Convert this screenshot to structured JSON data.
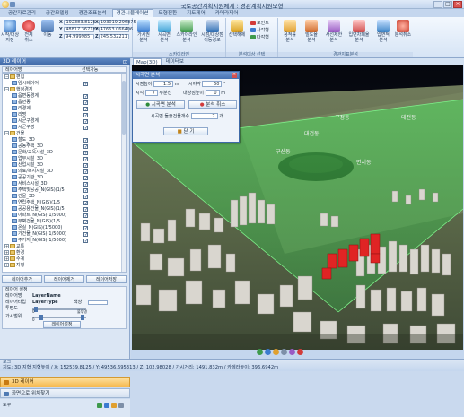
{
  "window": {
    "title": "국토공간계획지원체계 : 경관계획지원모형",
    "min": "–",
    "max": "□",
    "close": "×"
  },
  "tabs": [
    "공간자료관리",
    "공간모델링",
    "경관조표분석",
    "경관시뮬레이션",
    "모형전환",
    "지도제어",
    "카메라제어"
  ],
  "active_tab": 4,
  "ribbon": {
    "home_buttons": [
      {
        "label": "시작/대상\n지정",
        "icon": "globe-icon",
        "color": "#3b7bd0"
      },
      {
        "label": "전체\n취소",
        "icon": "cancel-icon",
        "color": "#d23b3b"
      },
      {
        "label": "이동",
        "icon": "move-icon",
        "color": "#5a86c6"
      }
    ],
    "coords": {
      "x_label": "X",
      "x": "192383.8125",
      "y_label": "Y",
      "y": "48817.367188",
      "z_label": "Z",
      "z": "94.999985",
      "x2": "193019.296875",
      "y2": "47663.066406",
      "z2": "245.532211"
    },
    "group1_label": "스카이라인",
    "buttons_sky": [
      {
        "label": "가시권\n분석",
        "color": "#4b8bd9"
      },
      {
        "label": "시곡면\n분석",
        "color": "#4fa7d8"
      },
      {
        "label": "스카이라인\n분석",
        "color": "#3e9a4c"
      },
      {
        "label": "시점/대상점\n이동경로",
        "color": "#2f6fb5"
      }
    ],
    "build_label": "선택해제",
    "small_items": [
      "포인트",
      "사각형",
      "다각형"
    ],
    "group2_label": "분석대상 선택",
    "buttons_analysis": [
      {
        "label": "용적률\n분석",
        "color": "#e0a030"
      },
      {
        "label": "밀도율\n분석",
        "color": "#cf6a2d"
      },
      {
        "label": "사선제한\n분석",
        "color": "#9a5bc4"
      },
      {
        "label": "입면차폐율\n분석",
        "color": "#d04f4f"
      },
      {
        "label": "입면적\n분석",
        "color": "#3f86c8"
      },
      {
        "label": "분석취소",
        "color": "#c43"
      }
    ],
    "group3_label": "경관지표분석"
  },
  "left_panel": {
    "title": "3D 레이어",
    "col1": "레이어명",
    "col2": "선택가능",
    "tree": [
      {
        "label": "편집",
        "type": "folder",
        "level": 0,
        "exp": "−",
        "check": false
      },
      {
        "label": "임시레이어",
        "type": "layer",
        "level": 1,
        "check": true
      },
      {
        "label": "행정경계",
        "type": "folder",
        "level": 0,
        "exp": "−",
        "check": false
      },
      {
        "label": "읍면동경계",
        "type": "layer",
        "level": 1,
        "check": true
      },
      {
        "label": "읍면동",
        "type": "layer",
        "level": 1,
        "check": true
      },
      {
        "label": "리경계",
        "type": "layer",
        "level": 1,
        "check": true
      },
      {
        "label": "리명",
        "type": "layer",
        "level": 1,
        "check": true
      },
      {
        "label": "시군구경계",
        "type": "layer",
        "level": 1,
        "check": true
      },
      {
        "label": "시군구명",
        "type": "layer",
        "level": 1,
        "check": true
      },
      {
        "label": "건물",
        "type": "folder",
        "level": 0,
        "exp": "−",
        "check": false
      },
      {
        "label": "철도_3D",
        "type": "layer",
        "level": 1,
        "check": true
      },
      {
        "label": "공동주택_3D",
        "type": "layer",
        "level": 1,
        "check": true
      },
      {
        "label": "문화/교육시설_3D",
        "type": "layer",
        "level": 1,
        "check": true
      },
      {
        "label": "업무시설_3D",
        "type": "layer",
        "level": 1,
        "check": true
      },
      {
        "label": "산업시설_3D",
        "type": "layer",
        "level": 1,
        "check": true
      },
      {
        "label": "의료/복지시설_3D",
        "type": "layer",
        "level": 1,
        "check": true
      },
      {
        "label": "공공기관_3D",
        "type": "layer",
        "level": 1,
        "check": true
      },
      {
        "label": "서비스시설_3D",
        "type": "layer",
        "level": 1,
        "check": true
      },
      {
        "label": "주택및공공_N(GIS)(1/5",
        "type": "layer",
        "level": 1,
        "check": true
      },
      {
        "label": "건물_3D",
        "type": "layer",
        "level": 1,
        "check": true
      },
      {
        "label": "연립주택_N(GIS)(1/5",
        "type": "layer",
        "level": 1,
        "check": true
      },
      {
        "label": "공공용건물_N(GIS)(1/5",
        "type": "layer",
        "level": 1,
        "check": true
      },
      {
        "label": "아파트_N(GIS)(1/5000)",
        "type": "layer",
        "level": 1,
        "check": true
      },
      {
        "label": "무벽건물_N(GIS)(1/5",
        "type": "layer",
        "level": 1,
        "check": true
      },
      {
        "label": "온실_N(GIS)(1/5000)",
        "type": "layer",
        "level": 1,
        "check": true
      },
      {
        "label": "가건물_N(GIS)(1/5000)",
        "type": "layer",
        "level": 1,
        "check": true
      },
      {
        "label": "주거지_N(GIS)(1/5000)",
        "type": "layer",
        "level": 1,
        "check": true
      },
      {
        "label": "교통",
        "type": "folder",
        "level": 0,
        "exp": "+",
        "check": false
      },
      {
        "label": "환경",
        "type": "folder",
        "level": 0,
        "exp": "+",
        "check": false
      },
      {
        "label": "수계",
        "type": "folder",
        "level": 0,
        "exp": "+",
        "check": false
      },
      {
        "label": "지형",
        "type": "folder",
        "level": 0,
        "exp": "+",
        "check": false
      }
    ],
    "btn_add": "레이어추가",
    "btn_remove": "레이어제거",
    "btn_save": "레이어저장",
    "props_title": "레이어 설정",
    "prop_name_label": "레이어명",
    "prop_name": "LayerName",
    "prop_type_label": "레이어타입",
    "prop_type": "LayerType",
    "prop_color_label": "색상",
    "prop_trans_label": "투명도",
    "prop_trans_min": "0",
    "prop_trans_max": "불투명",
    "prop_vis_label": "가시범위",
    "prop_vis_min": "0",
    "apply": "레이어설정",
    "bar3d": "3D 레이어",
    "bar2": "화면으로 위치찾기",
    "bottom": "도구"
  },
  "map": {
    "tabs": [
      "Map(3D)",
      "데이터보"
    ],
    "labels": [
      {
        "text": "대전동"
      },
      {
        "text": "구정동"
      },
      {
        "text": "대건동"
      },
      {
        "text": "구산동"
      },
      {
        "text": "면서동"
      }
    ]
  },
  "dialog": {
    "title": "시곡면 분석",
    "view_height_label": "시점높이",
    "view_height": "1.5",
    "unit_m": "m",
    "view_width_label": "시야각",
    "view_width": "60",
    "unit_deg": "°",
    "start_label": "시각",
    "start_val": "7",
    "step_label": "부분선",
    "height_label": "대상점높이",
    "height_val": "0",
    "run": "시곡면 분석",
    "cancel": "분석 취소",
    "count_label": "시곡면 돌출건물개수",
    "count": "7",
    "count_unit": "개",
    "close": "닫 기"
  },
  "status": {
    "label": "로그",
    "text": "지도: 3D 지형  지형높이 / X: 152539.8125 / Y: 49536.695313 / Z: 102.98028 / 가시거리: 1491.832m / 카메라높이: 396.6942m"
  },
  "colors": {
    "accent": "#4672b2",
    "highlight": "#f6b94f",
    "building_red": "#e02424",
    "visibility_green": "#5bd66a"
  }
}
